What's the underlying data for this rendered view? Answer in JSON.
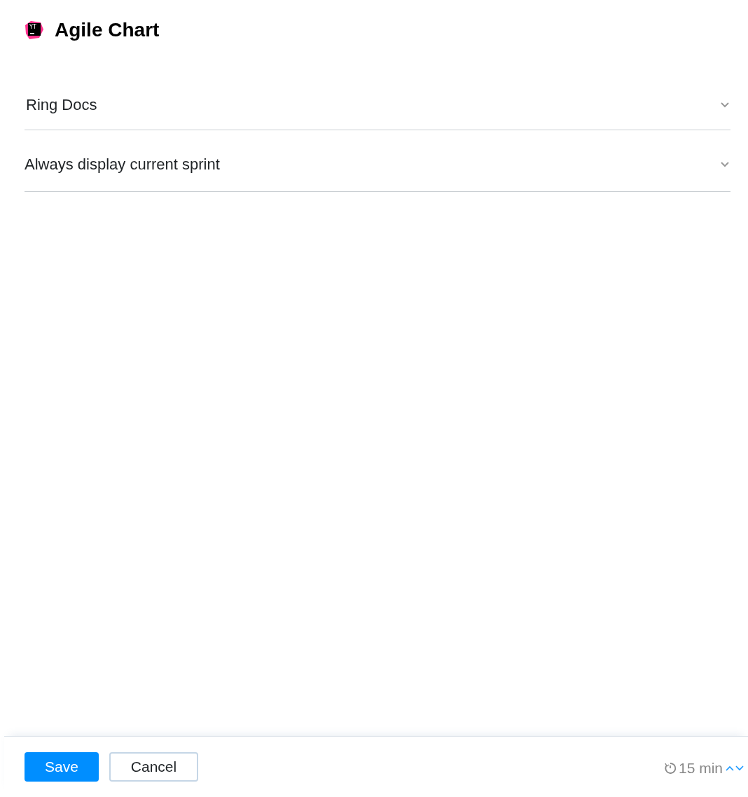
{
  "header": {
    "logo_text": "YT",
    "title": "Agile Chart"
  },
  "selects": [
    {
      "value": "Ring Docs"
    },
    {
      "value": "Always display current sprint"
    }
  ],
  "footer": {
    "buttons": [
      {
        "label": "Save",
        "kind": "primary"
      },
      {
        "label": "Cancel",
        "kind": "secondary"
      }
    ],
    "refresh": "15 min"
  }
}
